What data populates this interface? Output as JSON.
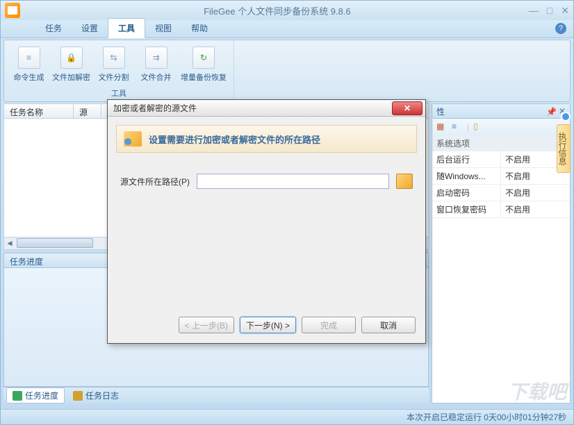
{
  "window": {
    "title": "FileGee 个人文件同步备份系统 9.8.6"
  },
  "menu": {
    "task": "任务",
    "settings": "设置",
    "tools": "工具",
    "view": "视图",
    "help": "帮助"
  },
  "ribbon": {
    "group_label": "工具",
    "cmd_gen": "命令生成",
    "encrypt": "文件加解密",
    "split": "文件分割",
    "merge": "文件合并",
    "incremental": "增量备份恢复"
  },
  "grid": {
    "col_taskname": "任务名称",
    "col_source": "源"
  },
  "progress": {
    "title": "任务进度"
  },
  "tabs": {
    "progress": "任务进度",
    "log": "任务日志"
  },
  "props": {
    "title": "性",
    "section": "系统选项",
    "rows": [
      {
        "name": "后台运行",
        "val": "不启用"
      },
      {
        "name": "随Windows...",
        "val": "不启用"
      },
      {
        "name": "启动密码",
        "val": "不启用"
      },
      {
        "name": "窗口恢复密码",
        "val": "不启用"
      }
    ]
  },
  "sidetab": "执行信息",
  "dialog": {
    "title": "加密或者解密的源文件",
    "banner": "设置需要进行加密或者解密文件的所在路径",
    "path_label": "源文件所在路径(P)",
    "path_value": "",
    "btn_prev": "< 上一步(B)",
    "btn_next": "下一步(N) >",
    "btn_finish": "完成",
    "btn_cancel": "取消"
  },
  "status": "本次开启已稳定运行  0天00小时01分钟27秒",
  "watermark": "下载吧"
}
